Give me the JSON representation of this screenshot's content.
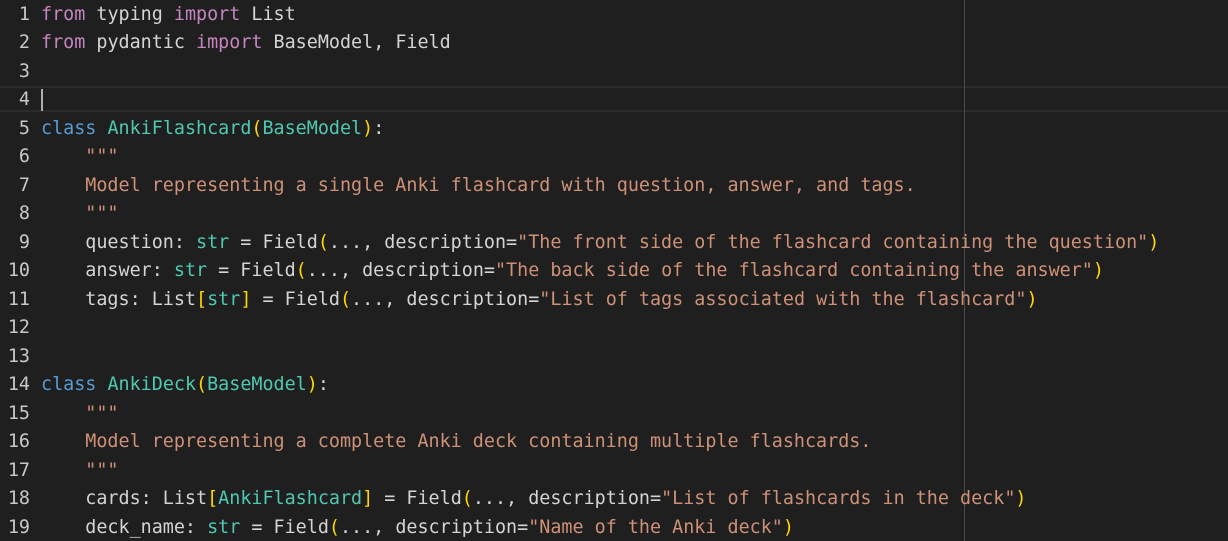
{
  "editor": {
    "language": "python",
    "active_line": 4,
    "lines": [
      {
        "n": "1",
        "tokens": [
          [
            "from",
            "imp"
          ],
          [
            " typing ",
            "txt"
          ],
          [
            "import",
            "imp"
          ],
          [
            " List",
            "txt"
          ]
        ]
      },
      {
        "n": "2",
        "tokens": [
          [
            "from",
            "imp"
          ],
          [
            " pydantic ",
            "txt"
          ],
          [
            "import",
            "imp"
          ],
          [
            " BaseModel, Field",
            "txt"
          ]
        ]
      },
      {
        "n": "3",
        "tokens": []
      },
      {
        "n": "4",
        "tokens": []
      },
      {
        "n": "5",
        "tokens": [
          [
            "class",
            "kw"
          ],
          [
            " ",
            "txt"
          ],
          [
            "AnkiFlashcard",
            "cls"
          ],
          [
            "(",
            "p1"
          ],
          [
            "BaseModel",
            "cls"
          ],
          [
            ")",
            "p1"
          ],
          [
            ":",
            "txt"
          ]
        ]
      },
      {
        "n": "6",
        "tokens": [
          [
            "    \"\"\"",
            "str"
          ]
        ]
      },
      {
        "n": "7",
        "tokens": [
          [
            "    Model representing a single Anki flashcard with question, answer, and tags.",
            "str"
          ]
        ]
      },
      {
        "n": "8",
        "tokens": [
          [
            "    \"\"\"",
            "str"
          ]
        ]
      },
      {
        "n": "9",
        "tokens": [
          [
            "    question: ",
            "txt"
          ],
          [
            "str",
            "cls"
          ],
          [
            " = Field",
            "txt"
          ],
          [
            "(",
            "p1"
          ],
          [
            "..., description=",
            "txt"
          ],
          [
            "\"The front side of the flashcard containing the question\"",
            "str"
          ],
          [
            ")",
            "p1"
          ]
        ]
      },
      {
        "n": "10",
        "tokens": [
          [
            "    answer: ",
            "txt"
          ],
          [
            "str",
            "cls"
          ],
          [
            " = Field",
            "txt"
          ],
          [
            "(",
            "p1"
          ],
          [
            "..., description=",
            "txt"
          ],
          [
            "\"The back side of the flashcard containing the answer\"",
            "str"
          ],
          [
            ")",
            "p1"
          ]
        ]
      },
      {
        "n": "11",
        "tokens": [
          [
            "    tags: List",
            "txt"
          ],
          [
            "[",
            "p1"
          ],
          [
            "str",
            "cls"
          ],
          [
            "]",
            "p1"
          ],
          [
            " = Field",
            "txt"
          ],
          [
            "(",
            "p1"
          ],
          [
            "..., description=",
            "txt"
          ],
          [
            "\"List of tags associated with the flashcard\"",
            "str"
          ],
          [
            ")",
            "p1"
          ]
        ]
      },
      {
        "n": "12",
        "tokens": []
      },
      {
        "n": "13",
        "tokens": []
      },
      {
        "n": "14",
        "tokens": [
          [
            "class",
            "kw"
          ],
          [
            " ",
            "txt"
          ],
          [
            "AnkiDeck",
            "cls"
          ],
          [
            "(",
            "p1"
          ],
          [
            "BaseModel",
            "cls"
          ],
          [
            ")",
            "p1"
          ],
          [
            ":",
            "txt"
          ]
        ]
      },
      {
        "n": "15",
        "tokens": [
          [
            "    \"\"\"",
            "str"
          ]
        ]
      },
      {
        "n": "16",
        "tokens": [
          [
            "    Model representing a complete Anki deck containing multiple flashcards.",
            "str"
          ]
        ]
      },
      {
        "n": "17",
        "tokens": [
          [
            "    \"\"\"",
            "str"
          ]
        ]
      },
      {
        "n": "18",
        "tokens": [
          [
            "    cards: List",
            "txt"
          ],
          [
            "[",
            "p1"
          ],
          [
            "AnkiFlashcard",
            "cls"
          ],
          [
            "]",
            "p1"
          ],
          [
            " = Field",
            "txt"
          ],
          [
            "(",
            "p1"
          ],
          [
            "..., description=",
            "txt"
          ],
          [
            "\"List of flashcards in the deck\"",
            "str"
          ],
          [
            ")",
            "p1"
          ]
        ]
      },
      {
        "n": "19",
        "tokens": [
          [
            "    deck_name: ",
            "txt"
          ],
          [
            "str",
            "cls"
          ],
          [
            " = Field",
            "txt"
          ],
          [
            "(",
            "p1"
          ],
          [
            "..., description=",
            "txt"
          ],
          [
            "\"Name of the Anki deck\"",
            "str"
          ],
          [
            ")",
            "p1"
          ]
        ]
      }
    ]
  },
  "theme": {
    "background": "#1f1f1f",
    "line_number": "#c8c8c8",
    "keyword": "#569cd6",
    "import_keyword": "#c586c0",
    "class_name": "#4ec9b0",
    "string": "#ce9178",
    "bracket": "#ffd700",
    "text": "#cccccc"
  }
}
